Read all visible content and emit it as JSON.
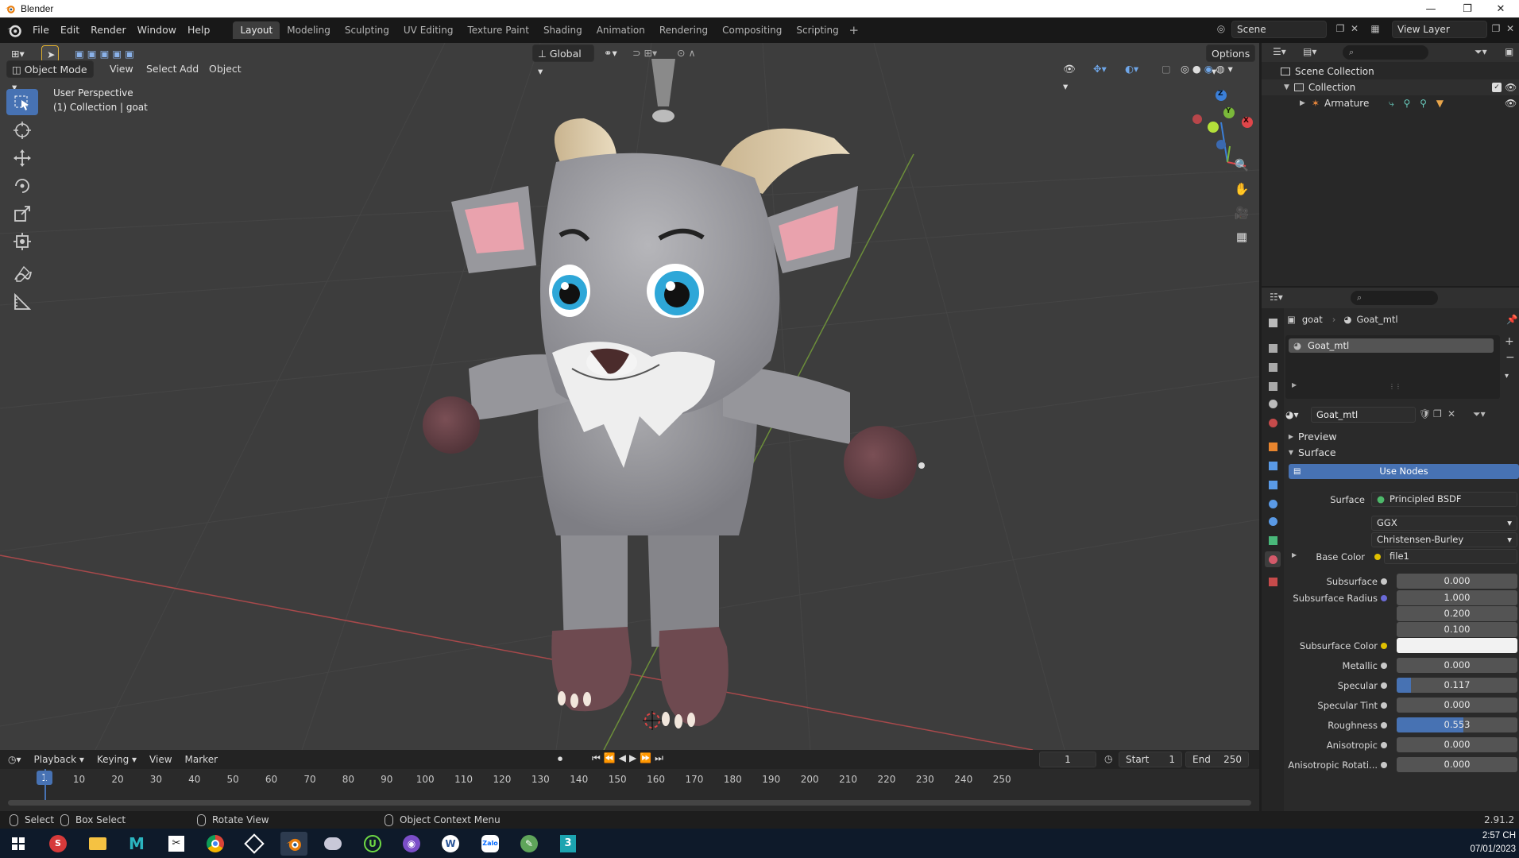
{
  "window": {
    "title": "Blender",
    "controls": [
      "—",
      "❐",
      "✕"
    ]
  },
  "menu": {
    "items": [
      "File",
      "Edit",
      "Render",
      "Window",
      "Help"
    ]
  },
  "workspaces": {
    "tabs": [
      "Layout",
      "Modeling",
      "Sculpting",
      "UV Editing",
      "Texture Paint",
      "Shading",
      "Animation",
      "Rendering",
      "Compositing",
      "Scripting"
    ],
    "active": "Layout",
    "add": "+"
  },
  "scene": {
    "name": "Scene"
  },
  "view_layer": {
    "name": "View Layer"
  },
  "viewport": {
    "mode": "Object Mode",
    "menus": [
      "View",
      "Select",
      "Add",
      "Object"
    ],
    "orientation": "Global",
    "options_label": "Options",
    "info_line1": "User Perspective",
    "info_line2": "(1) Collection | goat",
    "gizmo_axes": {
      "x": "X",
      "y": "Y",
      "z": "Z"
    },
    "colors": {
      "x_axis": "#e0464a",
      "y_axis": "#7ab83a",
      "z_axis": "#3b7fd8",
      "active": "#4772b3"
    }
  },
  "timeline": {
    "menus": [
      "Playback",
      "Keying",
      "View",
      "Marker"
    ],
    "current_frame": "1",
    "start_label": "Start",
    "start": "1",
    "end_label": "End",
    "end": "250",
    "ticks": [
      "10",
      "20",
      "30",
      "40",
      "50",
      "60",
      "70",
      "80",
      "90",
      "100",
      "110",
      "120",
      "130",
      "140",
      "150",
      "160",
      "170",
      "180",
      "190",
      "200",
      "210",
      "220",
      "230",
      "240",
      "250"
    ],
    "cursor": "1"
  },
  "statusbar": {
    "select": "Select",
    "box_select": "Box Select",
    "rotate_view": "Rotate View",
    "context_menu": "Object Context Menu",
    "version": "2.91.2"
  },
  "taskbar": {
    "apps": [
      "windows-start",
      "sketchup",
      "file-explorer",
      "maya",
      "image-app",
      "chrome",
      "unity",
      "blender",
      "mail",
      "upwork",
      "github",
      "word",
      "zalo",
      "paint",
      "3d-app"
    ],
    "time": "2:57 CH",
    "date": "07/01/2023"
  },
  "outliner": {
    "scene_collection": "Scene Collection",
    "collection": "Collection",
    "armature": "Armature"
  },
  "properties": {
    "breadcrumb_object": "goat",
    "breadcrumb_material": "Goat_mtl",
    "slot_name": "Goat_mtl",
    "material_name": "Goat_mtl",
    "panel_preview": "Preview",
    "panel_surface": "Surface",
    "use_nodes": "Use Nodes",
    "surface_label": "Surface",
    "surface_value": "Principled BSDF",
    "distribution": "GGX",
    "subsurface_method": "Christensen-Burley",
    "base_color_label": "Base Color",
    "base_color_value": "file1",
    "rows": [
      {
        "label": "Subsurface",
        "value": "0.000",
        "fill": 0.0
      },
      {
        "label": "Subsurface Radius",
        "value": "1.000",
        "fill": 0.0
      },
      {
        "label": "",
        "value": "0.200",
        "fill": 0.0
      },
      {
        "label": "",
        "value": "0.100",
        "fill": 0.0
      },
      {
        "label": "Subsurface Color",
        "value": "",
        "fill": 0.0
      },
      {
        "label": "Metallic",
        "value": "0.000",
        "fill": 0.0
      },
      {
        "label": "Specular",
        "value": "0.117",
        "fill": 0.117
      },
      {
        "label": "Specular Tint",
        "value": "0.000",
        "fill": 0.0
      },
      {
        "label": "Roughness",
        "value": "0.553",
        "fill": 0.553
      },
      {
        "label": "Anisotropic",
        "value": "0.000",
        "fill": 0.0
      },
      {
        "label": "Anisotropic Rotati...",
        "value": "0.000",
        "fill": 0.0
      }
    ]
  }
}
